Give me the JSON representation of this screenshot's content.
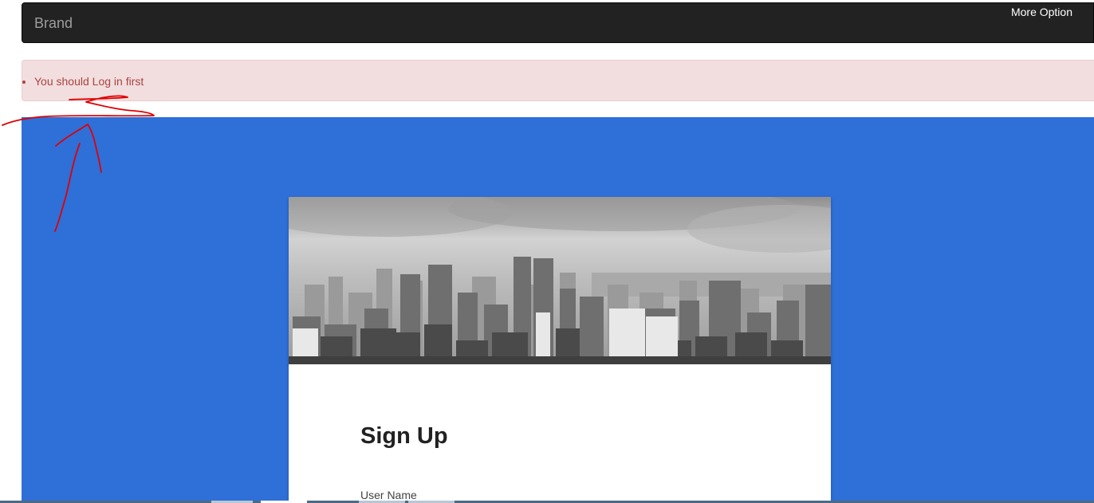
{
  "navbar": {
    "brand": "Brand",
    "more_option": "More Option",
    "background": "#222222"
  },
  "alert": {
    "items": [
      "You should Log in first"
    ],
    "text_color": "#a94442",
    "background": "#f2dede"
  },
  "hero": {
    "background": "#2f6fd8"
  },
  "card": {
    "image_icon": "city-skyline-photo",
    "title": "Sign Up",
    "user_name_label": "User Name"
  },
  "annotation": {
    "color": "#e00000",
    "icon": "hand-drawn-arrow-icon"
  }
}
